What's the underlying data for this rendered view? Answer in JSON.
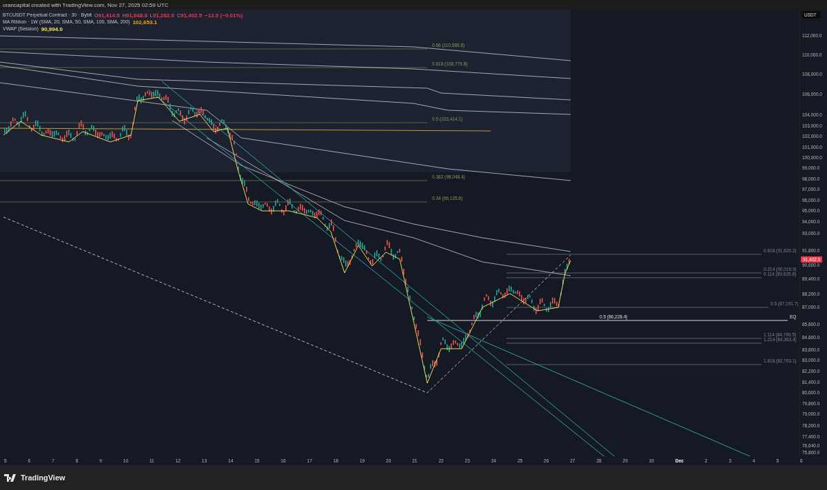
{
  "header": {
    "credit": "orancapital created with TradingView.com, Nov 27, 2025 02:59 UTC"
  },
  "legend": [
    {
      "name": "BTCUSDT Perpetual Contract · 30 · Bybit",
      "color": "#f23645",
      "readings": [
        {
          "key": "O",
          "value": "91,414.5"
        },
        {
          "key": "H",
          "value": "91,848.8"
        },
        {
          "key": "L",
          "value": "91,282.0"
        },
        {
          "key": "C",
          "value": "91,402.5"
        },
        {
          "value": "−12.0 (−0.01%)"
        }
      ]
    },
    {
      "name": "MA Ribbon · 1W (SMA, 20, SMA, 50, SMA, 100, SMA, 200)",
      "color": "#f7a600",
      "readings": [
        {
          "value": "102,653.1"
        }
      ]
    },
    {
      "name": "VWAP (Session)",
      "color": "#f5e84a",
      "readings": [
        {
          "value": "90,994.0"
        }
      ]
    }
  ],
  "fib_labels": [
    "0.66 (110,589.6)",
    "0.618 (108,779.8)",
    "0.5 (103,414.1)",
    "0.382 (98,048.4)",
    "0.34 (96,135.6)",
    "0.618 (91,620.2)",
    "0.214 (90,019.9)",
    "0.114 (89,625.8)",
    "0.5 (87,191.7)",
    "0.5 (86,228.4)",
    "EQ",
    "1.114 (84,799.5)",
    "1.214 (84,363.4)",
    "1.618 (82,763.1)"
  ],
  "price_axis": {
    "unit": "USDT",
    "last_price": "91,402.5",
    "ticks": [
      "112,000.0",
      "110,000.0",
      "108,000.0",
      "106,000.0",
      "104,000.0",
      "103,000.0",
      "102,000.0",
      "101,000.0",
      "100,000.0",
      "99,000.0",
      "98,000.0",
      "97,000.0",
      "96,000.0",
      "95,000.0",
      "94,000.0",
      "93,000.0",
      "91,800.0",
      "90,600.0",
      "89,400.0",
      "88,200.0",
      "87,000.0",
      "85,800.0",
      "84,800.0",
      "83,800.0",
      "83,000.0",
      "82,200.0",
      "81,400.0",
      "80,600.0",
      "79,800.0",
      "79,000.0",
      "78,200.0",
      "77,400.0",
      "76,640.0",
      "75,800.0"
    ]
  },
  "time_axis": [
    {
      "label": "5",
      "kind": "day"
    },
    {
      "label": "6",
      "kind": "day"
    },
    {
      "label": "7",
      "kind": "day"
    },
    {
      "label": "8",
      "kind": "day"
    },
    {
      "label": "9",
      "kind": "day"
    },
    {
      "label": "10",
      "kind": "day"
    },
    {
      "label": "11",
      "kind": "day"
    },
    {
      "label": "12",
      "kind": "day"
    },
    {
      "label": "13",
      "kind": "day"
    },
    {
      "label": "14",
      "kind": "day"
    },
    {
      "label": "15",
      "kind": "day"
    },
    {
      "label": "16",
      "kind": "day"
    },
    {
      "label": "17",
      "kind": "day"
    },
    {
      "label": "18",
      "kind": "day"
    },
    {
      "label": "19",
      "kind": "day"
    },
    {
      "label": "20",
      "kind": "day"
    },
    {
      "label": "21",
      "kind": "day"
    },
    {
      "label": "22",
      "kind": "day"
    },
    {
      "label": "23",
      "kind": "day"
    },
    {
      "label": "24",
      "kind": "day"
    },
    {
      "label": "25",
      "kind": "day"
    },
    {
      "label": "26",
      "kind": "day"
    },
    {
      "label": "27",
      "kind": "day"
    },
    {
      "label": "28",
      "kind": "day"
    },
    {
      "label": "29",
      "kind": "day"
    },
    {
      "label": "30",
      "kind": "day"
    },
    {
      "label": "Dec",
      "kind": "month"
    },
    {
      "label": "2",
      "kind": "day"
    },
    {
      "label": "3",
      "kind": "day"
    },
    {
      "label": "4",
      "kind": "day"
    },
    {
      "label": "5",
      "kind": "day"
    },
    {
      "label": "6",
      "kind": "day"
    }
  ],
  "footer": {
    "brand": "TradingView"
  }
}
